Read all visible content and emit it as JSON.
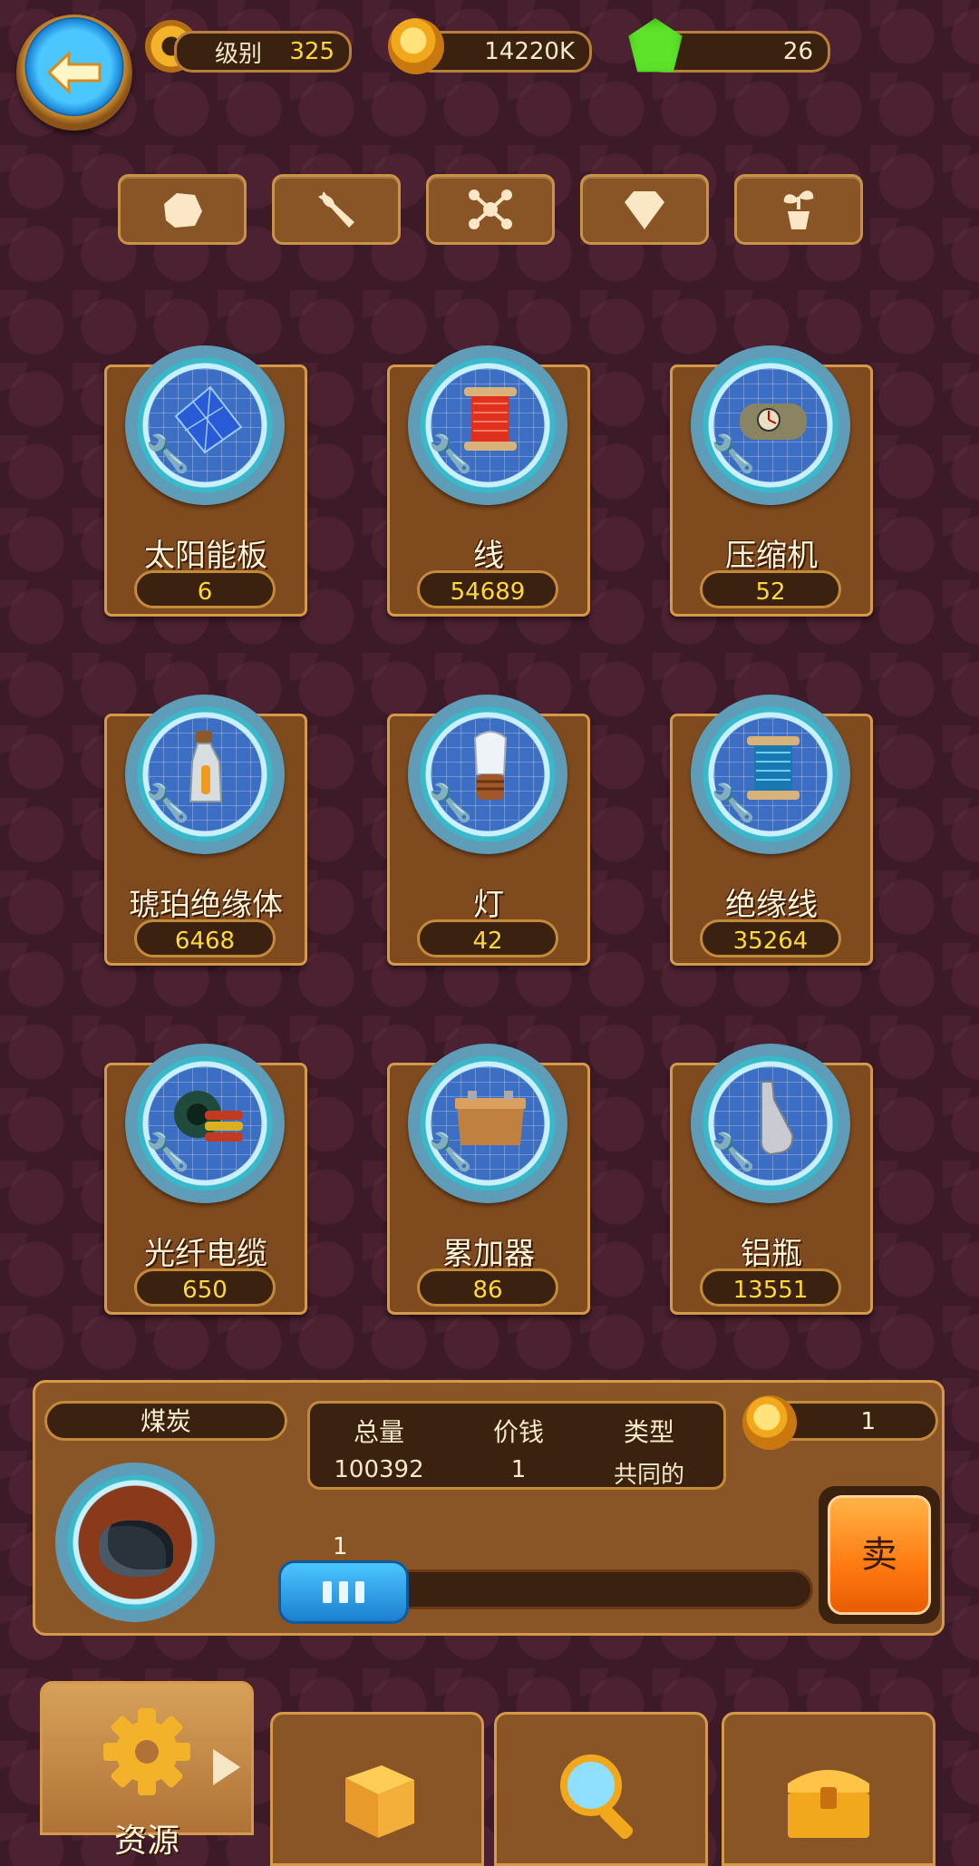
{
  "top_bar": {
    "level_label": "级别",
    "level_value": "325",
    "coins": "14220K",
    "gems": "26"
  },
  "category_tabs": [
    {
      "icon": "rock-icon"
    },
    {
      "icon": "wrench-icon"
    },
    {
      "icon": "molecule-icon"
    },
    {
      "icon": "diamond-icon"
    },
    {
      "icon": "plant-pot-icon"
    }
  ],
  "items": [
    {
      "name": "太阳能板",
      "count": "6",
      "icon": "solar-panel-icon"
    },
    {
      "name": "线",
      "count": "54689",
      "icon": "thread-spool-icon"
    },
    {
      "name": "压缩机",
      "count": "52",
      "icon": "compressor-icon"
    },
    {
      "name": "琥珀绝缘体",
      "count": "6468",
      "icon": "amber-insulator-icon"
    },
    {
      "name": "灯",
      "count": "42",
      "icon": "light-bulb-icon"
    },
    {
      "name": "绝缘线",
      "count": "35264",
      "icon": "insulated-wire-icon"
    },
    {
      "name": "光纤电缆",
      "count": "650",
      "icon": "fiber-cable-icon"
    },
    {
      "name": "累加器",
      "count": "86",
      "icon": "battery-icon"
    },
    {
      "name": "铝瓶",
      "count": "13551",
      "icon": "aluminum-bottle-icon"
    }
  ],
  "selected": {
    "name": "煤炭",
    "total_label": "总量",
    "total_value": "100392",
    "price_label": "价钱",
    "price_value": "1",
    "type_label": "类型",
    "type_value": "共同的",
    "sell_price": "1",
    "quantity": "1",
    "sell_label": "卖"
  },
  "bottom_nav": [
    {
      "label": "资源",
      "icon": "gear-icon",
      "active": true
    },
    {
      "label": "",
      "icon": "dice-icon"
    },
    {
      "label": "",
      "icon": "magnifier-icon"
    },
    {
      "label": "",
      "icon": "treasure-chest-icon"
    }
  ],
  "colors": {
    "background": "#3d1a28",
    "card": "#7f4a1e",
    "accent_yellow": "#ffd83a",
    "button_blue": "#1b7fd0",
    "sell_orange": "#ff7a10"
  }
}
